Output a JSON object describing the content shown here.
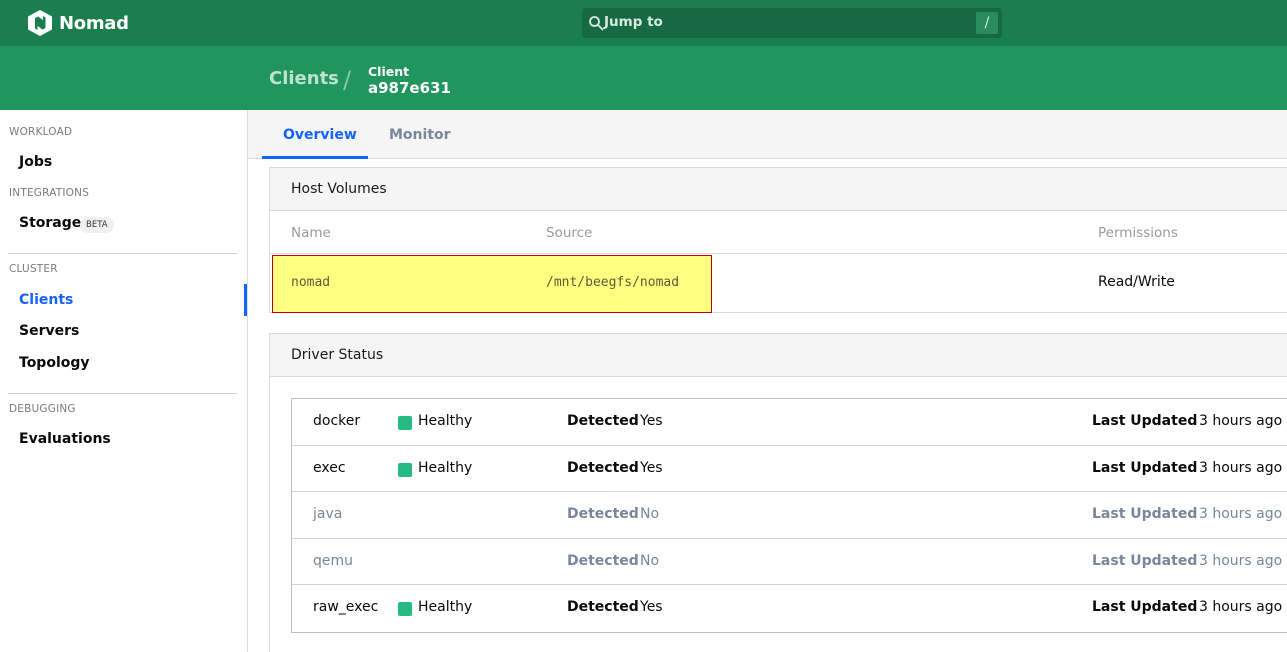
{
  "brand": {
    "name": "Nomad"
  },
  "search": {
    "placeholder": "Jump to",
    "shortcut": "/"
  },
  "breadcrumb": {
    "parent": "Clients",
    "separator": "/",
    "label": "Client",
    "id": "a987e631"
  },
  "sidebar": {
    "sections": [
      {
        "label": "WORKLOAD",
        "items": [
          "Jobs"
        ]
      },
      {
        "label": "INTEGRATIONS",
        "items": [
          "Storage"
        ],
        "badge": "BETA"
      },
      {
        "label": "CLUSTER",
        "items": [
          "Clients",
          "Servers",
          "Topology"
        ],
        "active": "Clients"
      },
      {
        "label": "DEBUGGING",
        "items": [
          "Evaluations"
        ]
      }
    ]
  },
  "tabs": [
    {
      "label": "Overview",
      "active": true
    },
    {
      "label": "Monitor",
      "active": false
    }
  ],
  "host_volumes": {
    "title": "Host Volumes",
    "columns": [
      "Name",
      "Source",
      "Permissions"
    ],
    "rows": [
      {
        "name": "nomad",
        "source": "/mnt/beegfs/nomad",
        "permissions": "Read/Write"
      }
    ]
  },
  "driver_status": {
    "title": "Driver Status",
    "detected_label": "Detected",
    "updated_label": "Last Updated",
    "rows": [
      {
        "name": "docker",
        "health": "Healthy",
        "detected": "Yes",
        "updated": "3 hours ago",
        "muted": false
      },
      {
        "name": "exec",
        "health": "Healthy",
        "detected": "Yes",
        "updated": "3 hours ago",
        "muted": false
      },
      {
        "name": "java",
        "health": "",
        "detected": "No",
        "updated": "3 hours ago",
        "muted": true
      },
      {
        "name": "qemu",
        "health": "",
        "detected": "No",
        "updated": "3 hours ago",
        "muted": true
      },
      {
        "name": "raw_exec",
        "health": "Healthy",
        "detected": "Yes",
        "updated": "3 hours ago",
        "muted": false
      }
    ]
  },
  "colors": {
    "nav": "#1b7e4f",
    "subnav": "#21955e",
    "active": "#1563ff",
    "healthy": "#25ba81",
    "highlight": "#ffff80"
  }
}
